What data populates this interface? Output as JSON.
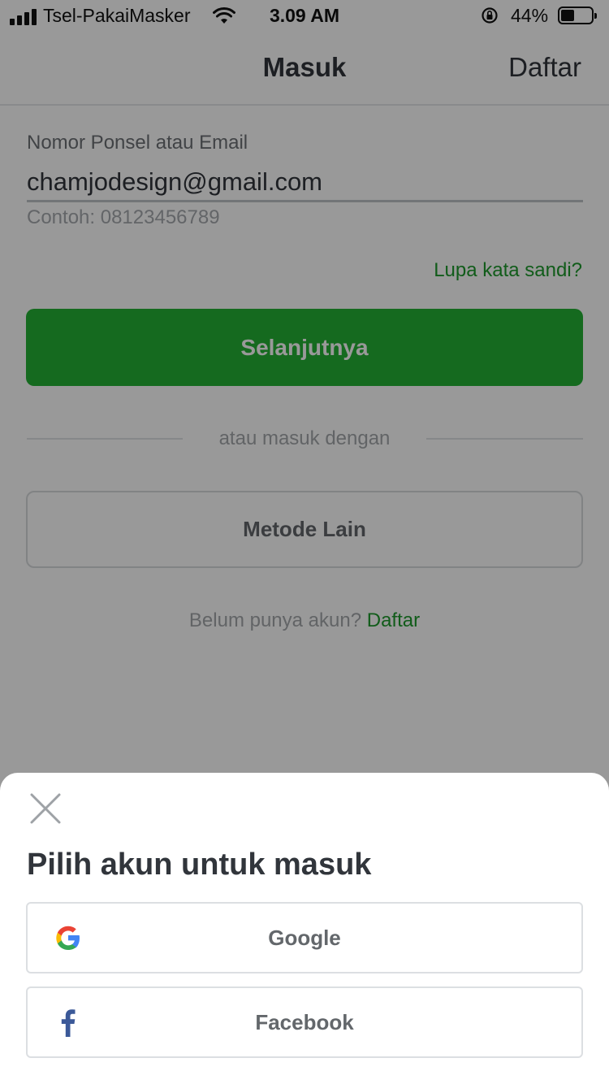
{
  "status_bar": {
    "carrier": "Tsel-PakaiMasker",
    "time": "3.09 AM",
    "battery_percent": "44%",
    "battery_level": 0.44,
    "icons": [
      "signal-icon",
      "wifi-icon",
      "rotation-lock-icon",
      "battery-icon"
    ]
  },
  "nav": {
    "title": "Masuk",
    "right_action": "Daftar"
  },
  "form": {
    "field_label": "Nomor Ponsel atau Email",
    "field_value": "chamjodesign@gmail.com",
    "field_hint": "Contoh: 08123456789",
    "forgot_password": "Lupa kata sandi?",
    "next_button": "Selanjutnya",
    "divider_text": "atau masuk dengan",
    "other_method_button": "Metode Lain",
    "signup_prompt": "Belum punya akun?",
    "signup_link": "Daftar"
  },
  "sheet": {
    "title": "Pilih akun untuk masuk",
    "providers": [
      {
        "label": "Google",
        "icon": "google-icon"
      },
      {
        "label": "Facebook",
        "icon": "facebook-icon"
      }
    ]
  },
  "colors": {
    "brand_green": "#23b134",
    "link_green": "#1d9a2c",
    "overlay": "rgba(0,0,0,0.4)",
    "facebook_blue": "#3b5998"
  }
}
